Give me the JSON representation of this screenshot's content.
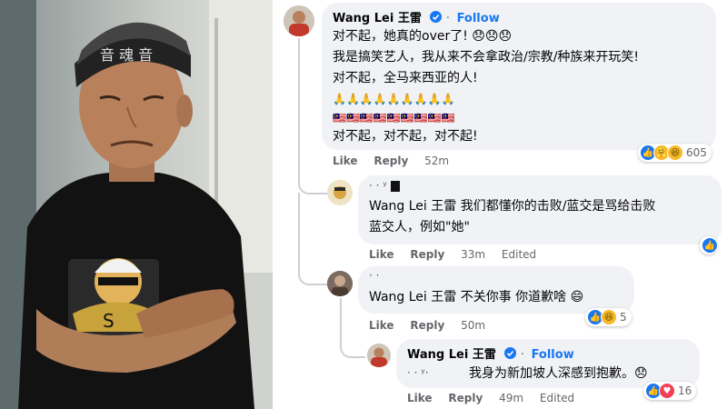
{
  "photo": {
    "headband_text": "音 魂 音",
    "shirt_caption": "S"
  },
  "comments": [
    {
      "author": "Wang Lei 王雷",
      "follow_label": "Follow",
      "lines": [
        "对不起，她真的over了! 😞😞😞",
        "我是搞笑艺人，我从来不会拿政治/宗教/种族来开玩笑!",
        "对不起，全马来西亚的人!",
        "🙏🙏🙏🙏🙏🙏🙏🙏🙏",
        "🇲🇾🇲🇾🇲🇾🇲🇾🇲🇾🇲🇾🇲🇾🇲🇾🇲🇾",
        "对不起，对不起，对不起!"
      ],
      "like_label": "Like",
      "reply_label": "Reply",
      "time": "52m",
      "reaction_count": "605"
    },
    {
      "author_partial": "·  ·  ʸ",
      "lines": [
        "Wang Lei 王雷 我们都懂你的击败/蓝交是骂给击败",
        "蓝交人，例如\"她\""
      ],
      "like_label": "Like",
      "reply_label": "Reply",
      "time": "33m",
      "edited_label": "Edited"
    },
    {
      "author_partial": "· ·",
      "lines": [
        "Wang Lei 王雷 不关你事 你道歉啥 😄"
      ],
      "like_label": "Like",
      "reply_label": "Reply",
      "time": "50m",
      "reaction_count": "5"
    },
    {
      "author": "Wang Lei 王雷",
      "follow_label": "Follow",
      "author_partial": "·  ·  ʸ·",
      "lines": [
        "我身为新加坡人深感到抱歉。😞"
      ],
      "like_label": "Like",
      "reply_label": "Reply",
      "time": "49m",
      "edited_label": "Edited",
      "reaction_count": "16"
    }
  ],
  "colors": {
    "accent": "#1877f2",
    "bubble": "#f0f2f5",
    "meta": "#65676b"
  }
}
